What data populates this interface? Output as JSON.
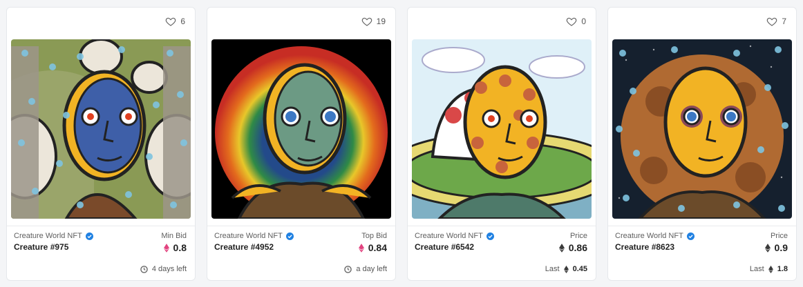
{
  "cards": [
    {
      "likes": "6",
      "collection": "Creature World NFT",
      "name": "Creature #975",
      "price_label": "Min Bid",
      "price": "0.8",
      "footer_text": "4 days left",
      "footer_type": "time",
      "eth_color": "#e2437f"
    },
    {
      "likes": "19",
      "collection": "Creature World NFT",
      "name": "Creature #4952",
      "price_label": "Top Bid",
      "price": "0.84",
      "footer_text": "a day left",
      "footer_type": "time",
      "eth_color": "#e2437f"
    },
    {
      "likes": "0",
      "collection": "Creature World NFT",
      "name": "Creature #6542",
      "price_label": "Price",
      "price": "0.86",
      "footer_label": "Last",
      "footer_price": "0.45",
      "footer_type": "last",
      "eth_color": "#3a3a3a"
    },
    {
      "likes": "7",
      "collection": "Creature World NFT",
      "name": "Creature #8623",
      "price_label": "Price",
      "price": "0.9",
      "footer_label": "Last",
      "footer_price": "1.8",
      "footer_type": "last",
      "eth_color": "#3a3a3a"
    }
  ],
  "colors": {
    "verified": "#2081e2"
  },
  "icons": {
    "like": "heart-outline-icon",
    "verified": "verified-badge-icon",
    "currency": "ethereum-icon",
    "time": "clock-icon"
  }
}
